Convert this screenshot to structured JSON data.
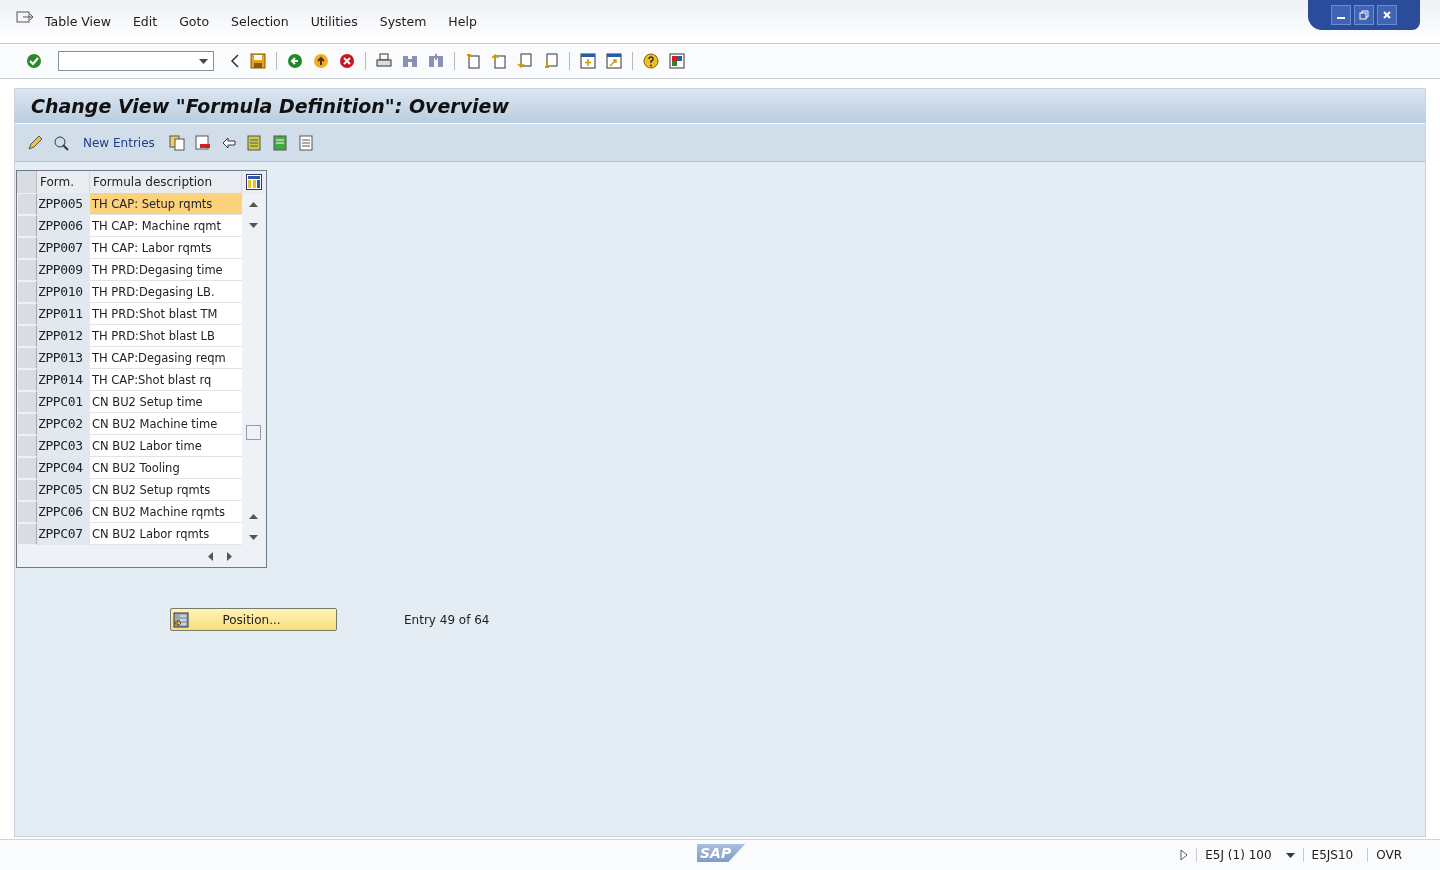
{
  "menu": [
    "Table View",
    "Edit",
    "Goto",
    "Selection",
    "Utilities",
    "System",
    "Help"
  ],
  "title": "Change View \"Formula Definition\": Overview",
  "app_toolbar": {
    "new_entries": "New Entries"
  },
  "table": {
    "columns": [
      "Form.",
      "Formula description"
    ],
    "rows": [
      {
        "form": "ZPP005",
        "description": "TH CAP: Setup rqmts",
        "selected": true
      },
      {
        "form": "ZPP006",
        "description": "TH CAP: Machine rqmt",
        "selected": false
      },
      {
        "form": "ZPP007",
        "description": "TH CAP: Labor rqmts",
        "selected": false
      },
      {
        "form": "ZPP009",
        "description": "TH PRD:Degasing time",
        "selected": false
      },
      {
        "form": "ZPP010",
        "description": "TH PRD:Degasing LB.",
        "selected": false
      },
      {
        "form": "ZPP011",
        "description": "TH PRD:Shot blast TM",
        "selected": false
      },
      {
        "form": "ZPP012",
        "description": "TH PRD:Shot blast LB",
        "selected": false
      },
      {
        "form": "ZPP013",
        "description": "TH CAP:Degasing reqm",
        "selected": false
      },
      {
        "form": "ZPP014",
        "description": "TH CAP:Shot blast rq",
        "selected": false
      },
      {
        "form": "ZPPC01",
        "description": "CN BU2 Setup time",
        "selected": false
      },
      {
        "form": "ZPPC02",
        "description": "CN BU2 Machine time",
        "selected": false
      },
      {
        "form": "ZPPC03",
        "description": "CN BU2 Labor time",
        "selected": false
      },
      {
        "form": "ZPPC04",
        "description": "CN BU2 Tooling",
        "selected": false
      },
      {
        "form": "ZPPC05",
        "description": "CN BU2 Setup rqmts",
        "selected": false
      },
      {
        "form": "ZPPC06",
        "description": "CN BU2 Machine rqmts",
        "selected": false
      },
      {
        "form": "ZPPC07",
        "description": "CN BU2 Labor rqmts",
        "selected": false
      }
    ]
  },
  "position_button": "Position...",
  "entry_info": "Entry 49 of 64",
  "status_bar": {
    "logo": "SAP",
    "system": "E5J (1) 100",
    "server": "E5JS10",
    "mode": "OVR"
  }
}
